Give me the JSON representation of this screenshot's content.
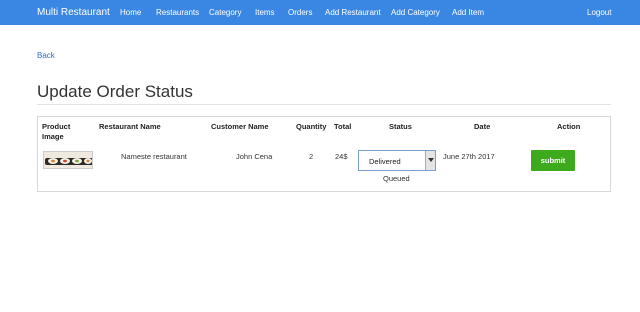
{
  "navbar": {
    "brand": "Multi Restaurant",
    "items": [
      {
        "label": "Home"
      },
      {
        "label": "Restaurants"
      },
      {
        "label": "Category"
      },
      {
        "label": "Items"
      },
      {
        "label": "Orders"
      },
      {
        "label": "Add Restaurant"
      },
      {
        "label": "Add Category"
      },
      {
        "label": "Add Item"
      }
    ],
    "logout": "Logout",
    "color": "#3a86e3"
  },
  "back_link": "Back",
  "page_title": "Update Order Status",
  "table": {
    "headers": {
      "product_image_line1": "Product",
      "product_image_line2": "Image",
      "restaurant_name": "Restaurant Name",
      "customer_name": "Customer Name",
      "quantity": "Quantity",
      "total": "Total",
      "status": "Status",
      "date": "Date",
      "action": "Action"
    },
    "row": {
      "restaurant_name": "Nameste restaurant",
      "customer_name": "John Cena",
      "quantity": "2",
      "total": "24$",
      "status_selected": "Delivered",
      "status_option_visible": "Queued",
      "date": "June 27th 2017",
      "action_label": "submit"
    }
  },
  "colors": {
    "submit": "#3daa1e",
    "link": "#2a6fc7"
  }
}
